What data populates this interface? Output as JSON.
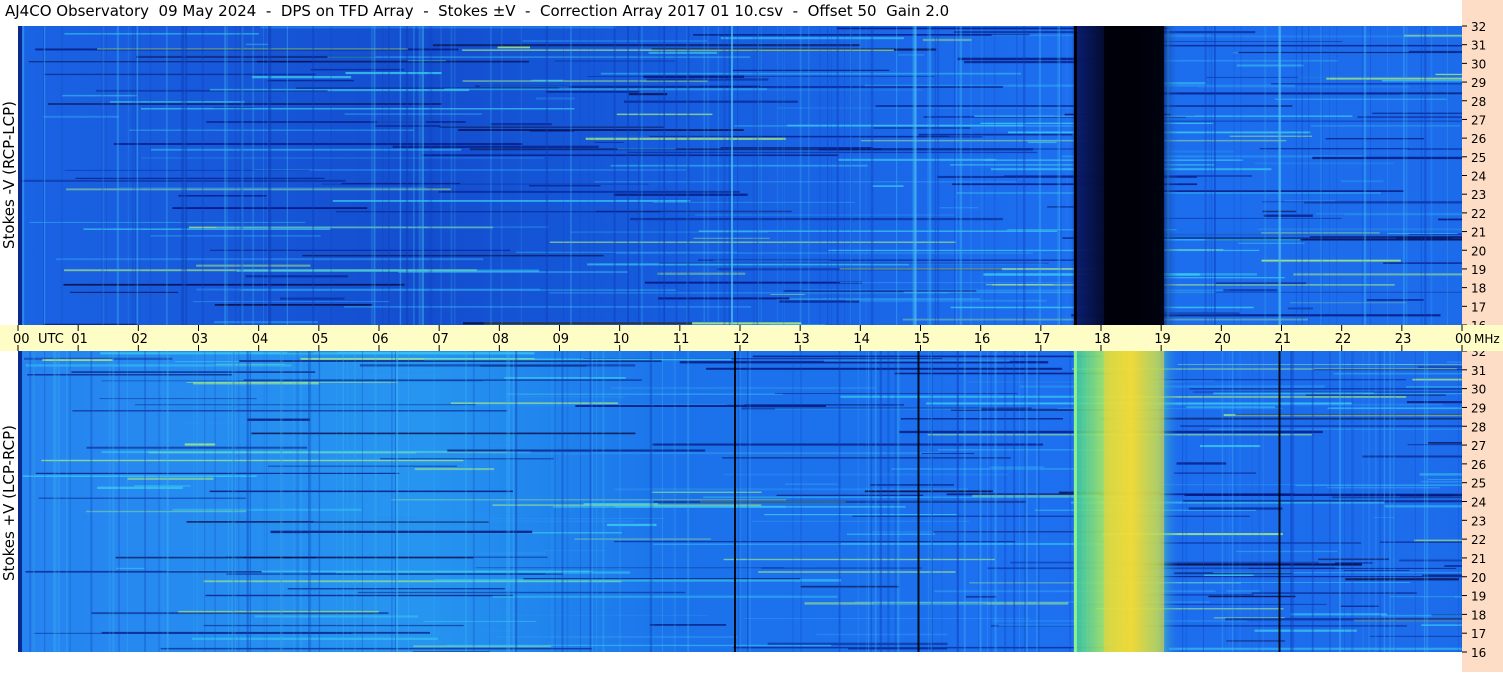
{
  "title": "AJ4CO Observatory  09 May 2024  -  DPS on TFD Array  -  Stokes ±V  -  Correction Array 2017 01 10.csv  -  Offset 50  Gain 2.0",
  "colors": {
    "background_blue": "#1c6ef0",
    "dark_blue": "#02082c",
    "burst_yellow": "#f2ea3c",
    "time_strip": "#fffdc6",
    "freq_strip": "#fdddc6"
  },
  "time_axis": {
    "labels": [
      "00",
      "01",
      "02",
      "03",
      "04",
      "05",
      "06",
      "07",
      "08",
      "09",
      "10",
      "11",
      "12",
      "13",
      "14",
      "15",
      "16",
      "17",
      "18",
      "19",
      "20",
      "21",
      "22",
      "23",
      "00"
    ],
    "utc_label": "UTC",
    "unit_label": "MHz"
  },
  "chart_data": [
    {
      "type": "heatmap",
      "title": "AJ4CO Observatory  09 May 2024  -  DPS on TFD Array  -  Stokes ±V  -  Correction Array 2017 01 10.csv  -  Offset 50  Gain 2.0",
      "ylabel": "Stokes -V (RCP-LCP)",
      "xlabel": "UTC",
      "x_range_hours": [
        0,
        24
      ],
      "y_range_mhz": [
        16,
        32
      ],
      "y_ticks": [
        32,
        31,
        30,
        29,
        28,
        27,
        26,
        25,
        24,
        23,
        22,
        21,
        20,
        19,
        18,
        17,
        16
      ],
      "features": [
        {
          "kind": "dark_band",
          "from_hour": 17.55,
          "to_hour": 19.3,
          "peak_hour": 18.55,
          "description": "RCP-dominant emission"
        },
        {
          "kind": "faint_vertical",
          "hours": [
            11.85,
            14.9,
            20.95
          ]
        }
      ]
    },
    {
      "type": "heatmap",
      "ylabel": "Stokes +V (LCP-RCP)",
      "xlabel": "UTC",
      "x_range_hours": [
        0,
        24
      ],
      "y_range_mhz": [
        16,
        32
      ],
      "y_ticks": [
        32,
        31,
        30,
        29,
        28,
        27,
        26,
        25,
        24,
        23,
        22,
        21,
        20,
        19,
        18,
        17,
        16
      ],
      "features": [
        {
          "kind": "bright_band",
          "from_hour": 17.55,
          "to_hour": 19.3,
          "peak_hour": 18.55
        },
        {
          "kind": "dark_vertical",
          "hours": [
            11.9,
            14.95,
            20.95
          ]
        }
      ]
    }
  ]
}
